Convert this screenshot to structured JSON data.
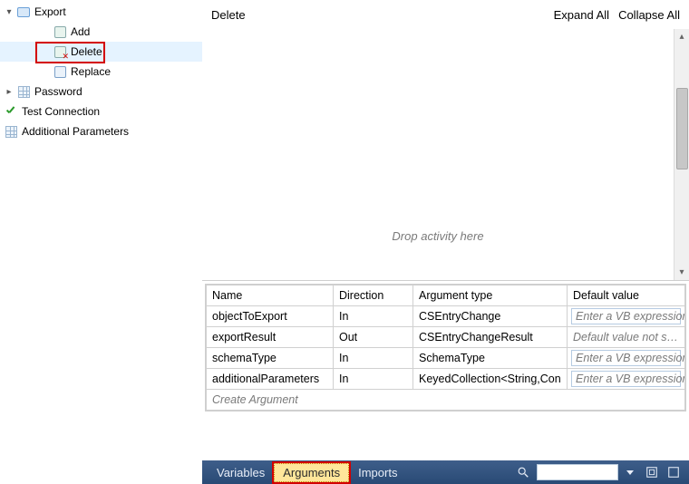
{
  "tree": {
    "items": [
      {
        "label": "Export",
        "expander": "▾"
      },
      {
        "label": "Add"
      },
      {
        "label": "Delete"
      },
      {
        "label": "Replace"
      },
      {
        "label": "Password",
        "expander": "▸"
      },
      {
        "label": "Test Connection"
      },
      {
        "label": "Additional Parameters"
      }
    ]
  },
  "toolbar": {
    "breadcrumb": "Delete",
    "expand_all": "Expand All",
    "collapse_all": "Collapse All"
  },
  "canvas": {
    "drop_hint": "Drop activity here"
  },
  "grid": {
    "headers": {
      "name": "Name",
      "direction": "Direction",
      "argtype": "Argument type",
      "default": "Default value"
    },
    "rows": [
      {
        "name": "objectToExport",
        "direction": "In",
        "argtype": "CSEntryChange",
        "default": "Enter a VB expression"
      },
      {
        "name": "exportResult",
        "direction": "Out",
        "argtype": "CSEntryChangeResult",
        "default": "Default value not suppo"
      },
      {
        "name": "schemaType",
        "direction": "In",
        "argtype": "SchemaType",
        "default": "Enter a VB expression"
      },
      {
        "name": "additionalParameters",
        "direction": "In",
        "argtype": "KeyedCollection<String,Con",
        "default": "Enter a VB expression"
      }
    ],
    "create": "Create Argument"
  },
  "tabs": {
    "variables": "Variables",
    "arguments": "Arguments",
    "imports": "Imports"
  }
}
